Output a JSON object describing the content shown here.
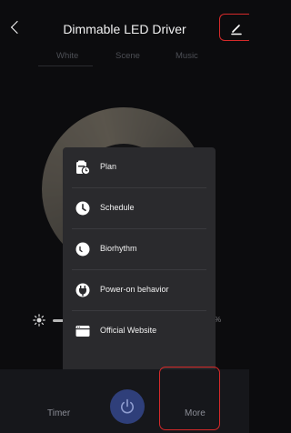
{
  "header": {
    "title": "Dimmable LED Driver"
  },
  "tabs": [
    {
      "label": "White"
    },
    {
      "label": "Scene"
    },
    {
      "label": "Music"
    }
  ],
  "popup_menu": {
    "items": [
      {
        "label": "Plan",
        "icon": "plan-icon"
      },
      {
        "label": "Schedule",
        "icon": "clock-icon"
      },
      {
        "label": "Biorhythm",
        "icon": "biorhythm-icon"
      },
      {
        "label": "Power-on behavior",
        "icon": "plug-icon"
      },
      {
        "label": "Official Website",
        "icon": "website-icon"
      }
    ]
  },
  "brightness": {
    "percent_suffix": "%"
  },
  "bottom_bar": {
    "timer_label": "Timer",
    "more_label": "More"
  },
  "colors": {
    "background": "#0c0c0e",
    "popup": "#2a2a2d",
    "power_button": "#2f3f7a",
    "highlight": "#d62a2a"
  }
}
